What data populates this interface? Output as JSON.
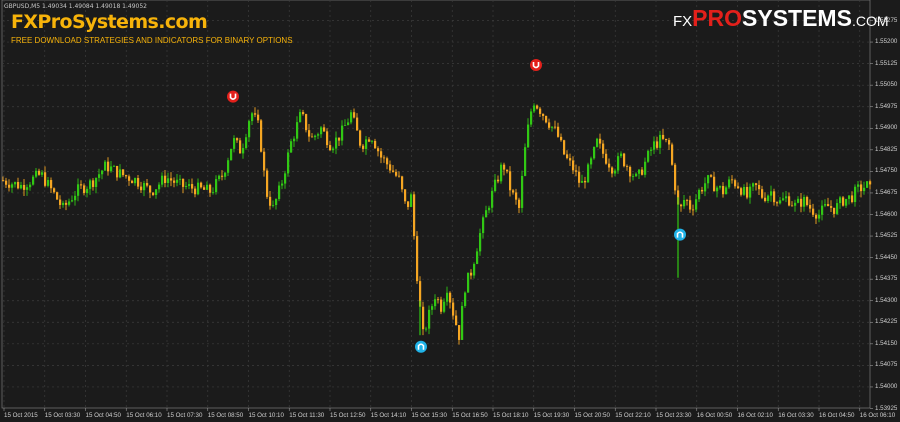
{
  "header": {
    "symbol_line": "GBPUSD,M5  1.49034 1.49084 1.49018 1.49052"
  },
  "brand": {
    "name": "FXProSystems.com",
    "tagline": "FREE DOWNLOAD STRATEGIES AND INDICATORS FOR BINARY OPTIONS"
  },
  "logo": {
    "prefix": "FX",
    "pro": "PRO",
    "systems": "SYSTEMS",
    "suffix": ".COM"
  },
  "colors": {
    "background": "#1b1b1b",
    "up_candle": "#31c814",
    "down_candle": "#f5a623",
    "grid": "#3c3c3c",
    "sell_arrow": "#e3201b",
    "buy_arrow": "#20b3e8"
  },
  "chart_data": {
    "type": "candlestick",
    "symbol": "GBPUSD",
    "timeframe": "M5",
    "ylim": [
      1.5393,
      1.5531
    ],
    "y_ticks": [
      "1.55275",
      "1.55200",
      "1.55125",
      "1.55050",
      "1.54975",
      "1.54900",
      "1.54825",
      "1.54750",
      "1.54675",
      "1.54600",
      "1.54525",
      "1.54450",
      "1.54375",
      "1.54300",
      "1.54225",
      "1.54150",
      "1.54075",
      "1.54000",
      "1.53925"
    ],
    "x_ticks": [
      "15 Oct 2015",
      "15 Oct 03:30",
      "15 Oct 04:50",
      "15 Oct 06:10",
      "15 Oct 07:30",
      "15 Oct 08:50",
      "15 Oct 10:10",
      "15 Oct 11:30",
      "15 Oct 12:50",
      "15 Oct 14:10",
      "15 Oct 15:30",
      "15 Oct 16:50",
      "15 Oct 18:10",
      "15 Oct 19:30",
      "15 Oct 20:50",
      "15 Oct 22:10",
      "15 Oct 23:30",
      "16 Oct 00:50",
      "16 Oct 02:10",
      "16 Oct 03:30",
      "16 Oct 04:50",
      "16 Oct 06:10"
    ],
    "close_path": [
      [
        0,
        1.5472
      ],
      [
        20,
        1.547
      ],
      [
        40,
        1.5474
      ],
      [
        55,
        1.5466
      ],
      [
        62,
        1.5462
      ],
      [
        75,
        1.5468
      ],
      [
        90,
        1.5471
      ],
      [
        105,
        1.5477
      ],
      [
        120,
        1.5474
      ],
      [
        135,
        1.5472
      ],
      [
        150,
        1.5468
      ],
      [
        165,
        1.5473
      ],
      [
        180,
        1.547
      ],
      [
        195,
        1.5469
      ],
      [
        210,
        1.5468
      ],
      [
        222,
        1.5474
      ],
      [
        232,
        1.5486
      ],
      [
        240,
        1.5482
      ],
      [
        250,
        1.5496
      ],
      [
        258,
        1.549
      ],
      [
        265,
        1.5468
      ],
      [
        272,
        1.5462
      ],
      [
        280,
        1.547
      ],
      [
        290,
        1.5485
      ],
      [
        300,
        1.5495
      ],
      [
        310,
        1.5486
      ],
      [
        320,
        1.549
      ],
      [
        330,
        1.5484
      ],
      [
        340,
        1.5488
      ],
      [
        350,
        1.5495
      ],
      [
        360,
        1.5484
      ],
      [
        370,
        1.5488
      ],
      [
        380,
        1.548
      ],
      [
        390,
        1.5476
      ],
      [
        398,
        1.5472
      ],
      [
        405,
        1.5462
      ],
      [
        410,
        1.5466
      ],
      [
        414,
        1.5448
      ],
      [
        418,
        1.543
      ],
      [
        422,
        1.5418
      ],
      [
        428,
        1.5425
      ],
      [
        434,
        1.5432
      ],
      [
        440,
        1.5428
      ],
      [
        446,
        1.5435
      ],
      [
        452,
        1.5426
      ],
      [
        458,
        1.5418
      ],
      [
        464,
        1.5435
      ],
      [
        470,
        1.544
      ],
      [
        478,
        1.5452
      ],
      [
        486,
        1.5462
      ],
      [
        494,
        1.547
      ],
      [
        502,
        1.5478
      ],
      [
        510,
        1.5468
      ],
      [
        518,
        1.5462
      ],
      [
        525,
        1.5486
      ],
      [
        532,
        1.55
      ],
      [
        540,
        1.5496
      ],
      [
        548,
        1.5492
      ],
      [
        556,
        1.5488
      ],
      [
        564,
        1.548
      ],
      [
        572,
        1.5476
      ],
      [
        580,
        1.547
      ],
      [
        588,
        1.5476
      ],
      [
        596,
        1.5485
      ],
      [
        604,
        1.548
      ],
      [
        612,
        1.5476
      ],
      [
        620,
        1.548
      ],
      [
        628,
        1.5476
      ],
      [
        636,
        1.5472
      ],
      [
        644,
        1.5478
      ],
      [
        652,
        1.5484
      ],
      [
        660,
        1.5486
      ],
      [
        668,
        1.5484
      ],
      [
        674,
        1.547
      ],
      [
        678,
        1.546
      ],
      [
        684,
        1.5466
      ],
      [
        690,
        1.5462
      ],
      [
        698,
        1.5468
      ],
      [
        706,
        1.5472
      ],
      [
        714,
        1.547
      ],
      [
        722,
        1.5468
      ],
      [
        730,
        1.5472
      ],
      [
        738,
        1.547
      ],
      [
        746,
        1.5466
      ],
      [
        754,
        1.547
      ],
      [
        762,
        1.5466
      ],
      [
        770,
        1.5468
      ],
      [
        778,
        1.5464
      ],
      [
        786,
        1.5466
      ],
      [
        794,
        1.5463
      ],
      [
        802,
        1.5465
      ],
      [
        810,
        1.5462
      ],
      [
        818,
        1.546
      ],
      [
        826,
        1.5463
      ],
      [
        834,
        1.5462
      ],
      [
        842,
        1.5465
      ],
      [
        850,
        1.5466
      ],
      [
        858,
        1.5469
      ],
      [
        866,
        1.547
      ],
      [
        870,
        1.5468
      ]
    ],
    "signals": [
      {
        "type": "sell",
        "x_pos": 233,
        "price": 1.5501
      },
      {
        "type": "sell",
        "x_pos": 536,
        "price": 1.5512
      },
      {
        "type": "buy",
        "x_pos": 421,
        "price": 1.5414
      },
      {
        "type": "buy",
        "x_pos": 680,
        "price": 1.5453
      }
    ]
  }
}
